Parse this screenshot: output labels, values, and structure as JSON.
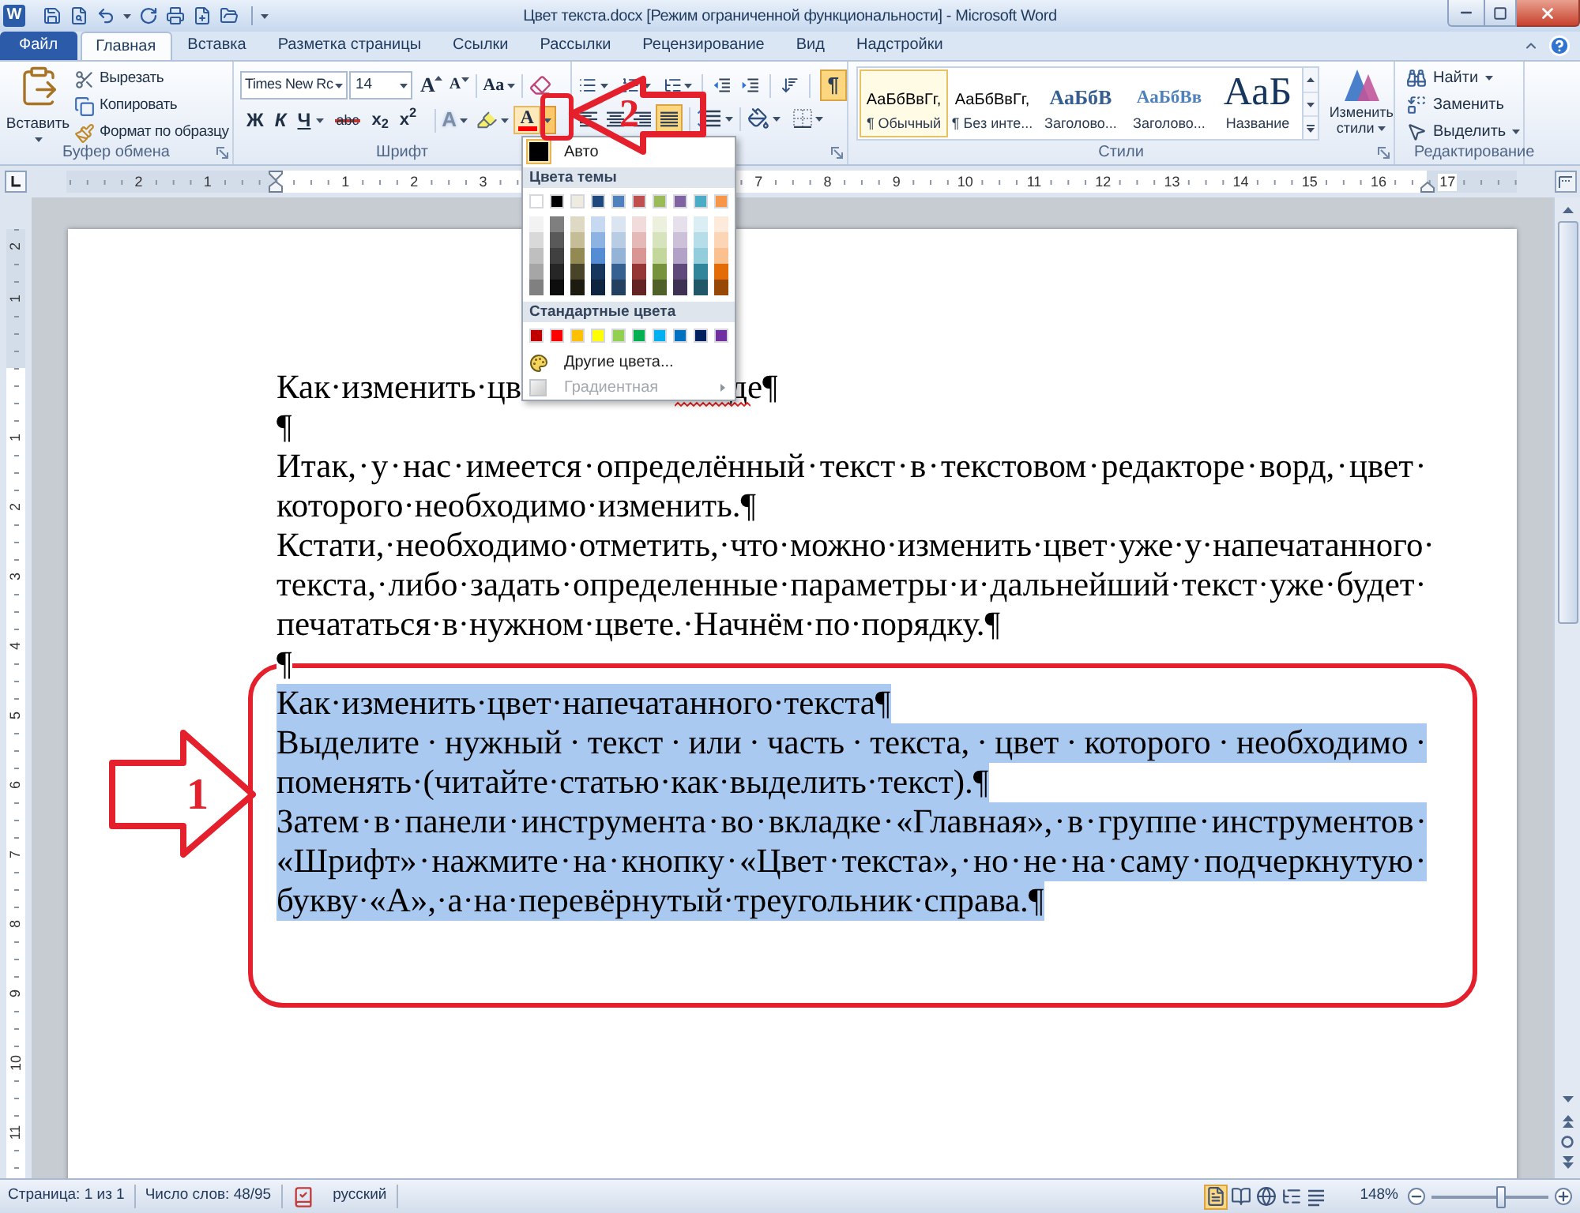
{
  "title_bar": {
    "logo": "W",
    "title": "Цвет текста.docx [Режим ограниченной функциональности] - Microsoft Word"
  },
  "tabs": [
    {
      "label": "Файл",
      "kind": "file",
      "selected": false
    },
    {
      "label": "Главная",
      "kind": "tab",
      "selected": true
    },
    {
      "label": "Вставка",
      "kind": "tab",
      "selected": false
    },
    {
      "label": "Разметка страницы",
      "kind": "tab",
      "selected": false
    },
    {
      "label": "Ссылки",
      "kind": "tab",
      "selected": false
    },
    {
      "label": "Рассылки",
      "kind": "tab",
      "selected": false
    },
    {
      "label": "Рецензирование",
      "kind": "tab",
      "selected": false
    },
    {
      "label": "Вид",
      "kind": "tab",
      "selected": false
    },
    {
      "label": "Надстройки",
      "kind": "tab",
      "selected": false
    }
  ],
  "clipboard": {
    "paste": "Вставить",
    "items": [
      {
        "kind": "cut",
        "label": "Вырезать"
      },
      {
        "kind": "copy",
        "label": "Копировать"
      },
      {
        "kind": "format_painter",
        "label": "Формат по образцу"
      }
    ],
    "label": "Буфер обмена"
  },
  "font": {
    "font_name": "Times New Rc",
    "font_size": "14",
    "grow": "A",
    "shrink": "A",
    "change_case": "Aa",
    "format_buttons": [
      {
        "kind": "bold",
        "label": "Ж"
      },
      {
        "kind": "italic",
        "label": "К"
      },
      {
        "kind": "underline",
        "label": "Ч"
      },
      {
        "kind": "strikethrough",
        "label": "abc"
      },
      {
        "kind": "subscript",
        "label": "x$_{2}$"
      },
      {
        "kind": "superscript",
        "label": "x$^{2}$"
      }
    ],
    "text_effects": "A",
    "font_color": {
      "label": "A",
      "expanded": true
    },
    "label": "Шрифт"
  },
  "paragraph": {
    "show_marks": {
      "label": "¶",
      "on": true
    },
    "alignment": [
      {
        "kind": "left",
        "selected": false
      },
      {
        "kind": "center",
        "selected": false
      },
      {
        "kind": "right",
        "selected": false
      },
      {
        "kind": "justify",
        "selected": true
      }
    ]
  },
  "styles": {
    "items": [
      {
        "preview": "АаБбВвГг,",
        "name": "¶ Обычный",
        "kind": "normal",
        "selected": true
      },
      {
        "preview": "АаБбВвГг,",
        "name": "¶ Без инте...",
        "kind": "normal",
        "selected": false
      },
      {
        "preview": "АаБбВ",
        "name": "Заголово...",
        "kind": "heading1",
        "selected": false
      },
      {
        "preview": "АаБбВв",
        "name": "Заголово...",
        "kind": "heading2",
        "selected": false
      },
      {
        "preview": "АаБ",
        "name": "Название",
        "kind": "title",
        "selected": false
      }
    ],
    "change_styles": "Изменить стили",
    "label": "Стили"
  },
  "editing": {
    "items": [
      {
        "kind": "find",
        "label": "Найти",
        "dropdown": true
      },
      {
        "kind": "replace",
        "label": "Заменить",
        "dropdown": false
      },
      {
        "kind": "select",
        "label": "Выделить",
        "dropdown": true
      }
    ],
    "label": "Редактирование"
  },
  "ruler": {
    "left_numbers": [
      "2",
      "1"
    ],
    "numbers": [
      "1",
      "2",
      "3"
    ],
    "numbers_after_menu": [
      "7",
      "8",
      "9",
      "10",
      "11",
      "12",
      "13",
      "14",
      "15",
      "16",
      "17"
    ]
  },
  "vertical_ruler": {
    "top_numbers": [
      "2",
      "1"
    ],
    "numbers": [
      "1",
      "2",
      "3",
      "4",
      "5",
      "6",
      "7",
      "8",
      "9",
      "10",
      "11"
    ]
  },
  "document": {
    "paragraphs": [
      {
        "kind": "covered",
        "selected": false,
        "parts": [
          "Как·изменить·цв",
          "де¶"
        ]
      },
      {
        "kind": "text",
        "selected": false,
        "lines": [
          "¶"
        ]
      },
      {
        "kind": "text",
        "selected": false,
        "lines": [
          "Итак,·у·нас·имеется·определённый·текст·в·текстовом·редакторе·ворд,·цвет·",
          "которого·необходимо·изменить.¶"
        ]
      },
      {
        "kind": "text",
        "selected": false,
        "lines": [
          "Кстати,·необходимо·отметить,·что·можно·изменить·цвет·уже·у·напечатанного·",
          "текста,·либо·задать·определенные·параметры·и·дальнейший·текст·уже·будет·",
          "печататься·в·нужном·цвете.·Начнём·по·порядку.¶"
        ]
      },
      {
        "kind": "text",
        "selected": false,
        "lines": [
          "¶"
        ]
      },
      {
        "kind": "text",
        "selected": true,
        "lines": [
          "Как·изменить·цвет·напечатанного·текста¶"
        ]
      },
      {
        "kind": "text",
        "selected": true,
        "lines": [
          "Выделите·нужный·текст·или·часть·текста,·цвет·которого·необходимо·",
          "поменять·(читайте·статью·как·выделить·текст).¶"
        ]
      },
      {
        "kind": "text",
        "selected": true,
        "lines": [
          "Затем·в·панели·инструмента·во·вкладке·«Главная»,·в·группе·инструментов·",
          "«Шрифт»·нажмите·на·кнопку·«Цвет·текста»,·но·не·на·саму·подчеркнутую·",
          "букву·«А»,·а·на·перевёрнутый·треугольник·справа.¶"
        ]
      }
    ]
  },
  "color_menu": {
    "auto": {
      "label": "Авто",
      "selected": true
    },
    "theme_heading": "Цвета темы",
    "theme_colors": [
      {
        "color": "#ffffff",
        "shades": [
          {
            "color": "#f2f2f2"
          },
          {
            "color": "#d9d9d9"
          },
          {
            "color": "#bfbfbf"
          },
          {
            "color": "#a6a6a6"
          },
          {
            "color": "#808080"
          }
        ]
      },
      {
        "color": "#000000",
        "shades": [
          {
            "color": "#7f7f7f"
          },
          {
            "color": "#595959"
          },
          {
            "color": "#404040"
          },
          {
            "color": "#262626"
          },
          {
            "color": "#0d0d0d"
          }
        ]
      },
      {
        "color": "#eeece1",
        "shades": [
          {
            "color": "#ddd9c3"
          },
          {
            "color": "#c4bd97"
          },
          {
            "color": "#938953"
          },
          {
            "color": "#494429"
          },
          {
            "color": "#1d1b10"
          }
        ]
      },
      {
        "color": "#1f497d",
        "shades": [
          {
            "color": "#c6d9f0"
          },
          {
            "color": "#8db3e2"
          },
          {
            "color": "#548dd4"
          },
          {
            "color": "#17365d"
          },
          {
            "color": "#0f243e"
          }
        ]
      },
      {
        "color": "#4f81bd",
        "shades": [
          {
            "color": "#dbe5f1"
          },
          {
            "color": "#b8cce4"
          },
          {
            "color": "#95b3d7"
          },
          {
            "color": "#366092"
          },
          {
            "color": "#244061"
          }
        ]
      },
      {
        "color": "#c0504d",
        "shades": [
          {
            "color": "#f2dcdb"
          },
          {
            "color": "#e5b9b7"
          },
          {
            "color": "#d99694"
          },
          {
            "color": "#953734"
          },
          {
            "color": "#632423"
          }
        ]
      },
      {
        "color": "#9bbb59",
        "shades": [
          {
            "color": "#ebf1dd"
          },
          {
            "color": "#d7e3bc"
          },
          {
            "color": "#c3d69b"
          },
          {
            "color": "#76923c"
          },
          {
            "color": "#4f6128"
          }
        ]
      },
      {
        "color": "#8064a2",
        "shades": [
          {
            "color": "#e5e0ec"
          },
          {
            "color": "#ccc1d9"
          },
          {
            "color": "#b2a2c7"
          },
          {
            "color": "#5f497a"
          },
          {
            "color": "#3f3151"
          }
        ]
      },
      {
        "color": "#4bacc6",
        "shades": [
          {
            "color": "#dbeef3"
          },
          {
            "color": "#b7dde8"
          },
          {
            "color": "#92cddc"
          },
          {
            "color": "#31859b"
          },
          {
            "color": "#205867"
          }
        ]
      },
      {
        "color": "#f79646",
        "shades": [
          {
            "color": "#fdeada"
          },
          {
            "color": "#fbd5b5"
          },
          {
            "color": "#fac08f"
          },
          {
            "color": "#e36c09"
          },
          {
            "color": "#974806"
          }
        ]
      }
    ],
    "standard_heading": "Стандартные цвета",
    "standard_colors": [
      {
        "color": "#c00000"
      },
      {
        "color": "#ff0000"
      },
      {
        "color": "#ffc000"
      },
      {
        "color": "#ffff00"
      },
      {
        "color": "#92d050"
      },
      {
        "color": "#00b050"
      },
      {
        "color": "#00b0f0"
      },
      {
        "color": "#0070c0"
      },
      {
        "color": "#002060"
      },
      {
        "color": "#7030a0"
      }
    ],
    "more_colors": "Другие цвета...",
    "gradient": {
      "label": "Градиентная",
      "disabled": true
    }
  },
  "annotations": [
    {
      "kind": "arrow_right",
      "label": "1"
    },
    {
      "kind": "arrow_left",
      "label": "2"
    }
  ],
  "status_bar": {
    "page": "Страница: 1 из 1",
    "words": "Число слов: 48/95",
    "language": "русский",
    "views": [
      {
        "kind": "print_layout",
        "selected": true
      },
      {
        "kind": "full_screen",
        "selected": false
      },
      {
        "kind": "web",
        "selected": false
      },
      {
        "kind": "outline",
        "selected": false
      },
      {
        "kind": "draft",
        "selected": false
      }
    ],
    "zoom": "148%",
    "zoom_slider": {
      "level": 0.6
    }
  }
}
